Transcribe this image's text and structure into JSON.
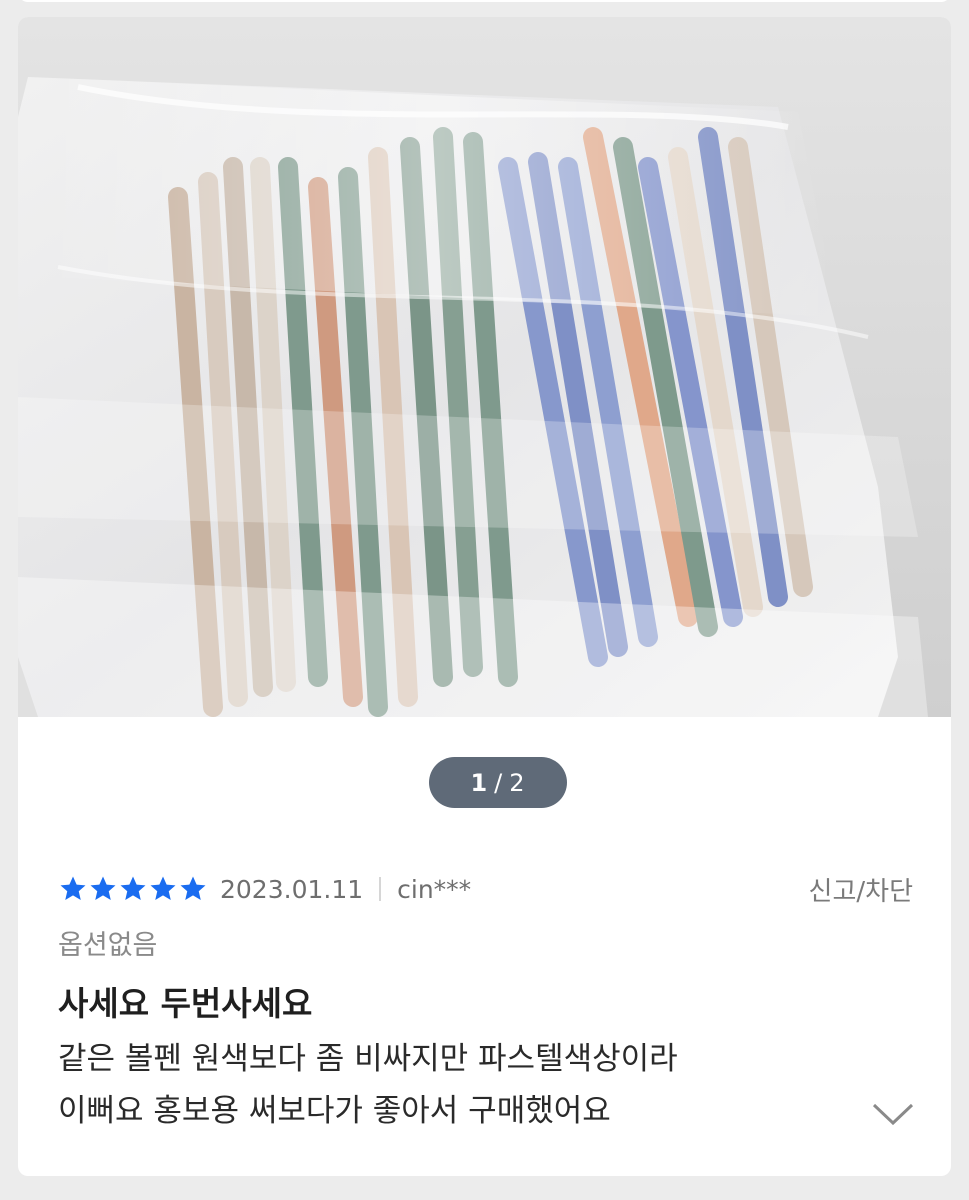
{
  "gallery": {
    "current": "1",
    "separator": "/",
    "total": "2",
    "image_subject": "pastel ballpoint pens in clear plastic bag"
  },
  "review": {
    "rating": 5,
    "rating_max": 5,
    "star_color": "#1a6cf0",
    "date": "2023.01.11",
    "user": "cin***",
    "report_label": "신고/차단",
    "option": "옵션없음",
    "title": "사세요 두번사세요",
    "body_line1": "같은 볼펜 원색보다 좀 비싸지만 파스텔색상이라",
    "body_line2": "이뻐요 홍보용 써보다가 좋아서 구매했어요",
    "expand_icon": "chevron-down-icon"
  }
}
